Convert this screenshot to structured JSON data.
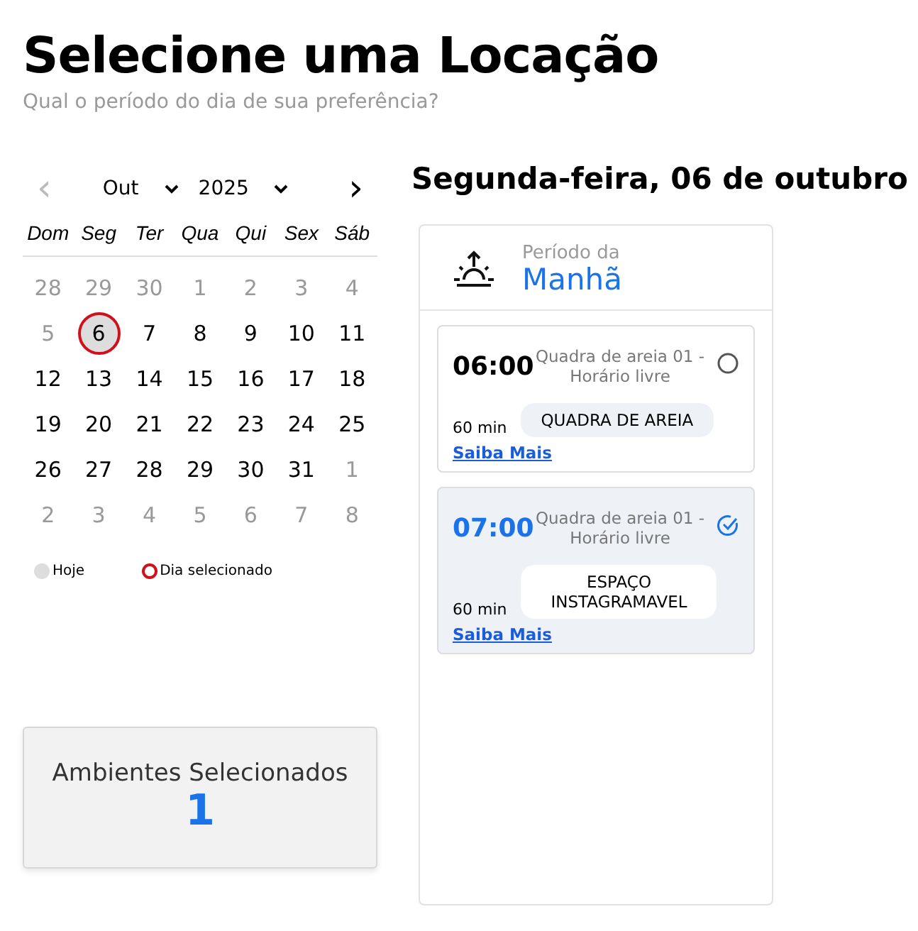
{
  "title": "Selecione uma Locação",
  "subtitle": "Qual o período do dia de sua preferência?",
  "calendar": {
    "prev": "‹",
    "month": "Out",
    "year": "2025",
    "next": "›",
    "weekdays": [
      "Dom",
      "Seg",
      "Ter",
      "Qua",
      "Qui",
      "Sex",
      "Sáb"
    ],
    "weeks": [
      [
        {
          "day": "28",
          "muted": true,
          "today": false,
          "selected": false
        },
        {
          "day": "29",
          "muted": true,
          "today": false,
          "selected": false
        },
        {
          "day": "30",
          "muted": true,
          "today": false,
          "selected": false
        },
        {
          "day": "1",
          "muted": true,
          "today": false,
          "selected": false
        },
        {
          "day": "2",
          "muted": true,
          "today": false,
          "selected": false
        },
        {
          "day": "3",
          "muted": true,
          "today": false,
          "selected": false
        },
        {
          "day": "4",
          "muted": true,
          "today": false,
          "selected": false
        }
      ],
      [
        {
          "day": "5",
          "muted": true,
          "today": false,
          "selected": false
        },
        {
          "day": "6",
          "muted": false,
          "today": true,
          "selected": true
        },
        {
          "day": "7",
          "muted": false,
          "today": false,
          "selected": false
        },
        {
          "day": "8",
          "muted": false,
          "today": false,
          "selected": false
        },
        {
          "day": "9",
          "muted": false,
          "today": false,
          "selected": false
        },
        {
          "day": "10",
          "muted": false,
          "today": false,
          "selected": false
        },
        {
          "day": "11",
          "muted": false,
          "today": false,
          "selected": false
        }
      ],
      [
        {
          "day": "12",
          "muted": false,
          "today": false,
          "selected": false
        },
        {
          "day": "13",
          "muted": false,
          "today": false,
          "selected": false
        },
        {
          "day": "14",
          "muted": false,
          "today": false,
          "selected": false
        },
        {
          "day": "15",
          "muted": false,
          "today": false,
          "selected": false
        },
        {
          "day": "16",
          "muted": false,
          "today": false,
          "selected": false
        },
        {
          "day": "17",
          "muted": false,
          "today": false,
          "selected": false
        },
        {
          "day": "18",
          "muted": false,
          "today": false,
          "selected": false
        }
      ],
      [
        {
          "day": "19",
          "muted": false,
          "today": false,
          "selected": false
        },
        {
          "day": "20",
          "muted": false,
          "today": false,
          "selected": false
        },
        {
          "day": "21",
          "muted": false,
          "today": false,
          "selected": false
        },
        {
          "day": "22",
          "muted": false,
          "today": false,
          "selected": false
        },
        {
          "day": "23",
          "muted": false,
          "today": false,
          "selected": false
        },
        {
          "day": "24",
          "muted": false,
          "today": false,
          "selected": false
        },
        {
          "day": "25",
          "muted": false,
          "today": false,
          "selected": false
        }
      ],
      [
        {
          "day": "26",
          "muted": false,
          "today": false,
          "selected": false
        },
        {
          "day": "27",
          "muted": false,
          "today": false,
          "selected": false
        },
        {
          "day": "28",
          "muted": false,
          "today": false,
          "selected": false
        },
        {
          "day": "29",
          "muted": false,
          "today": false,
          "selected": false
        },
        {
          "day": "30",
          "muted": false,
          "today": false,
          "selected": false
        },
        {
          "day": "31",
          "muted": false,
          "today": false,
          "selected": false
        },
        {
          "day": "1",
          "muted": true,
          "today": false,
          "selected": false
        }
      ],
      [
        {
          "day": "2",
          "muted": true,
          "today": false,
          "selected": false
        },
        {
          "day": "3",
          "muted": true,
          "today": false,
          "selected": false
        },
        {
          "day": "4",
          "muted": true,
          "today": false,
          "selected": false
        },
        {
          "day": "5",
          "muted": true,
          "today": false,
          "selected": false
        },
        {
          "day": "6",
          "muted": true,
          "today": false,
          "selected": false
        },
        {
          "day": "7",
          "muted": true,
          "today": false,
          "selected": false
        },
        {
          "day": "8",
          "muted": true,
          "today": false,
          "selected": false
        }
      ]
    ],
    "legend": [
      {
        "kind": "today",
        "label": "Hoje"
      },
      {
        "kind": "selected",
        "label": "Dia selecionado"
      }
    ]
  },
  "summary": {
    "label": "Ambientes Selecionados",
    "count": "1"
  },
  "date_heading": "Segunda-feira, 06 de outubro",
  "period": {
    "caption": "Período da",
    "name": "Manhã",
    "slots": [
      {
        "time": "06:00",
        "description": "Quadra de areia 01 - Horário livre",
        "duration": "60 min",
        "tag": "QUADRA DE AREIA",
        "link": "Saiba Mais",
        "selected": false
      },
      {
        "time": "07:00",
        "description": "Quadra de areia 01 - Horário livre",
        "duration": "60 min",
        "tag": "ESPAÇO INSTAGRAMAVEL",
        "link": "Saiba Mais",
        "selected": true
      }
    ]
  }
}
